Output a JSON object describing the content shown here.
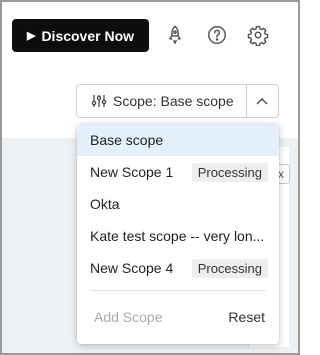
{
  "toolbar": {
    "discover_label": "Discover Now",
    "play_glyph": "▶",
    "icons": [
      "rocket-icon",
      "help-icon",
      "gear-icon"
    ]
  },
  "scope": {
    "button_label": "Scope: Base scope",
    "filter_icon": "sliders-icon",
    "toggle_icon": "chevron-up-icon"
  },
  "background": {
    "chip_glyph": "x"
  },
  "menu": {
    "items": [
      {
        "label": "Base scope",
        "badge": "",
        "selected": true
      },
      {
        "label": "New Scope 1",
        "badge": "Processing",
        "selected": false
      },
      {
        "label": "Okta",
        "badge": "",
        "selected": false
      },
      {
        "label": "Kate test scope -- very lon...",
        "badge": "",
        "selected": false
      },
      {
        "label": "New Scope 4",
        "badge": "Processing",
        "selected": false
      }
    ],
    "add_label": "Add Scope",
    "reset_label": "Reset"
  },
  "colors": {
    "discover_bg": "#0d0d0d",
    "selected_bg": "#e3f0fc",
    "badge_bg": "#eeeeee",
    "disabled_text": "#a9a9a9"
  }
}
